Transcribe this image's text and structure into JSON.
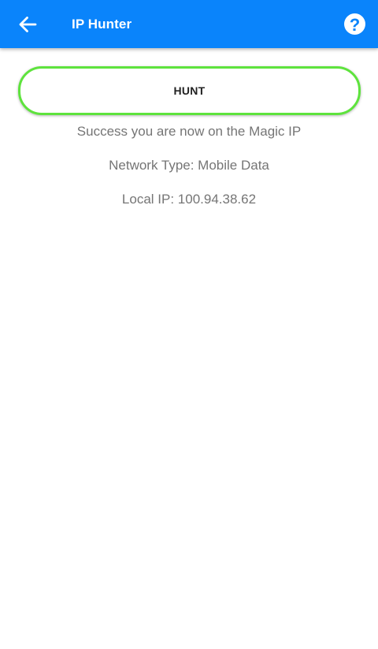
{
  "app_bar": {
    "title": "IP Hunter",
    "back_icon": "arrow-left-icon",
    "help_icon": "question-circle-icon",
    "help_glyph": "?",
    "background_color": "#0a84fb"
  },
  "main": {
    "hunt_button_label": "HUNT",
    "hunt_button_border_color": "#5ee33d",
    "status_message": "Success you are now on the Magic IP",
    "network_type": "Network Type: Mobile Data",
    "local_ip": "Local IP: 100.94.38.62"
  }
}
